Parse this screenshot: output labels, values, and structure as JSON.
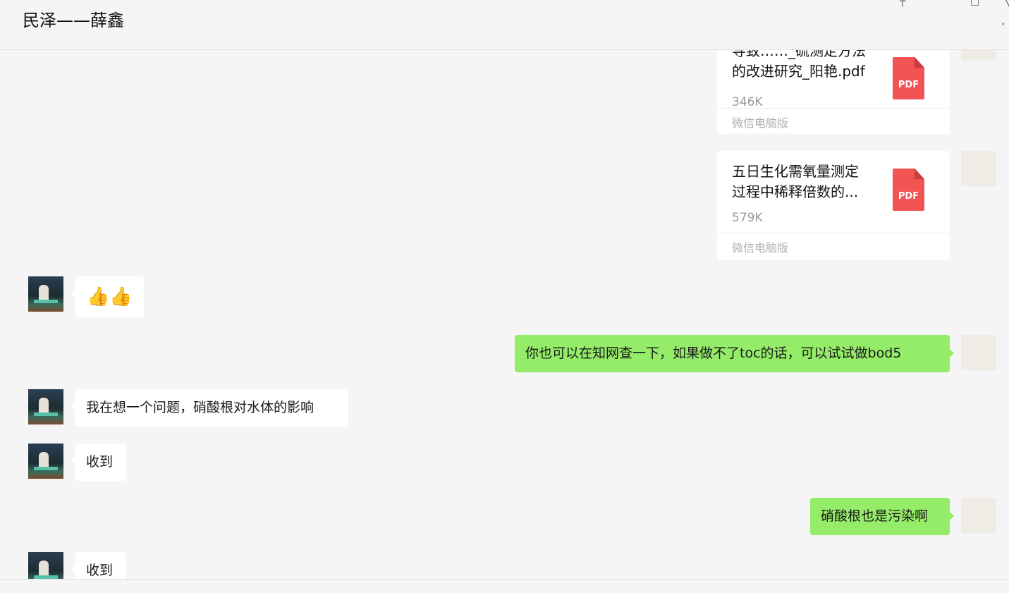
{
  "header": {
    "title": "民泽——薛鑫"
  },
  "messages": {
    "file1": {
      "name_line1": "导致……_硫测定方法",
      "name_line2": "的改进研究_阳艳.pdf",
      "size": "346K",
      "source": "微信电脑版",
      "icon_label": "PDF"
    },
    "file2": {
      "name_line1": "五日生化需氧量测定",
      "name_line2": "过程中稀释倍数的...",
      "size": "579K",
      "source": "微信电脑版",
      "icon_label": "PDF"
    },
    "emoji": "👍👍",
    "m_toc": "你也可以在知网查一下，如果做不了toc的话，可以试试做bod5",
    "m_nitrate_question": "我在想一个问题，硝酸根对水体的影响",
    "m_received1": "收到",
    "m_nitrate_pollution": "硝酸根也是污染啊",
    "m_received2": "收到"
  }
}
